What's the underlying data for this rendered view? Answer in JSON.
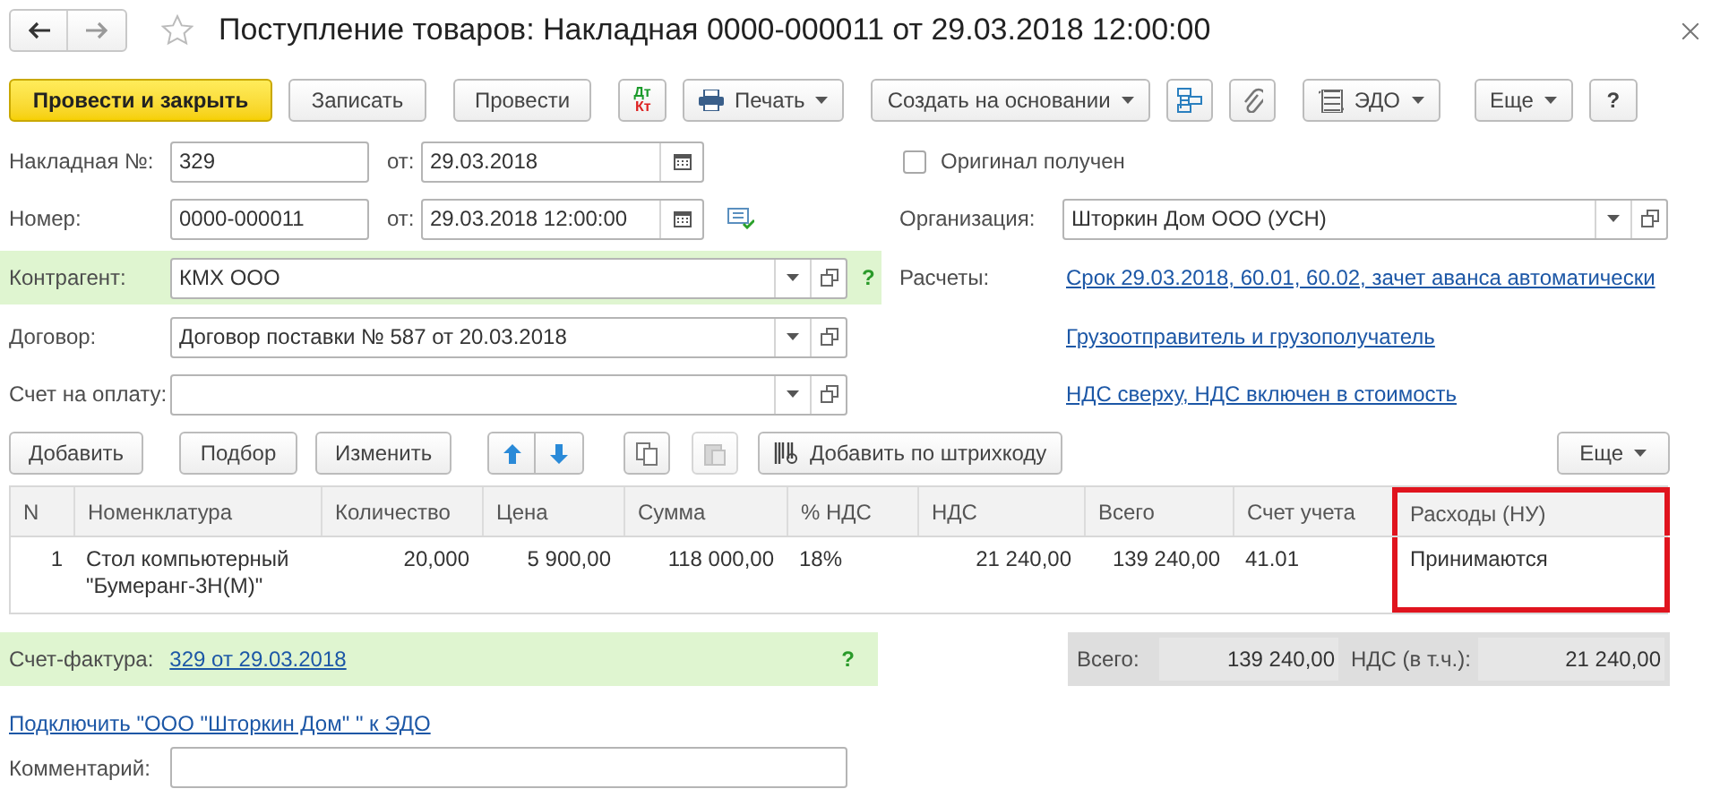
{
  "window": {
    "title": "Поступление товаров: Накладная 0000-000011 от 29.03.2018 12:00:00"
  },
  "toolbar": {
    "primary": "Провести и закрыть",
    "buttons": [
      {
        "kind": "text",
        "label": "Записать"
      },
      {
        "kind": "text",
        "label": "Провести"
      },
      {
        "kind": "dtkt",
        "debit": "Дт",
        "credit": "Кт"
      },
      {
        "kind": "menu",
        "label": "Печать"
      },
      {
        "kind": "menu",
        "label": "Создать на основании"
      },
      {
        "kind": "icon"
      },
      {
        "kind": "icon"
      },
      {
        "kind": "menu",
        "label": "ЭДО"
      },
      {
        "kind": "menu",
        "label": "Еще"
      },
      {
        "kind": "text",
        "label": "?"
      }
    ]
  },
  "header": {
    "invoice_no": {
      "label": "Накладная №:",
      "value": "329",
      "date_label": "от:",
      "date": "29.03.2018"
    },
    "number": {
      "label": "Номер:",
      "value": "0000-000011",
      "date_label": "от:",
      "date": "29.03.2018 12:00:00"
    },
    "original_received": {
      "label": "Оригинал получен",
      "checked": false
    },
    "organization": {
      "label": "Организация:",
      "value": "Шторкин Дом ООО (УСН)"
    },
    "counterparty": {
      "label": "Контрагент:",
      "value": "КМХ ООО",
      "help": "?"
    },
    "settlements": {
      "label": "Расчеты:",
      "link": "Срок 29.03.2018, 60.01, 60.02, зачет аванса автоматически"
    },
    "contract": {
      "label": "Договор:",
      "value": "Договор поставки № 587 от 20.03.2018"
    },
    "shipper_link": "Грузоотправитель и грузополучатель",
    "payment_invoice": {
      "label": "Счет на оплату:"
    },
    "vat_link": "НДС сверху, НДС включен в стоимость"
  },
  "table_toolbar": {
    "add": "Добавить",
    "pick": "Подбор",
    "edit": "Изменить",
    "barcode": "Добавить по штрихкоду",
    "more": "Еще"
  },
  "table": {
    "columns": [
      {
        "label": "N",
        "highlighted": false
      },
      {
        "label": "Номенклатура",
        "highlighted": false
      },
      {
        "label": "Количество",
        "highlighted": false
      },
      {
        "label": "Цена",
        "highlighted": false
      },
      {
        "label": "Сумма",
        "highlighted": false
      },
      {
        "label": "% НДС",
        "highlighted": false
      },
      {
        "label": "НДС",
        "highlighted": false
      },
      {
        "label": "Всего",
        "highlighted": false
      },
      {
        "label": "Счет учета",
        "highlighted": false
      },
      {
        "label": "Расходы (НУ)",
        "highlighted": true
      }
    ],
    "rows": [
      [
        "1",
        "Стол компьютерный \"Бумеранг-3Н(М)\"",
        "20,000",
        "5 900,00",
        "118 000,00",
        "18%",
        "21 240,00",
        "139 240,00",
        "41.01",
        "Принимаются"
      ]
    ]
  },
  "invoice": {
    "label": "Счет-фактура:",
    "link": "329 от 29.03.2018",
    "help": "?"
  },
  "totals": {
    "total_label": "Всего:",
    "total": "139 240,00",
    "vat_label": "НДС (в т.ч.):",
    "vat": "21 240,00"
  },
  "edo_link": "Подключить \"ООО \"Шторкин Дом\" \" к ЭДО",
  "comment": {
    "label": "Комментарий:"
  }
}
